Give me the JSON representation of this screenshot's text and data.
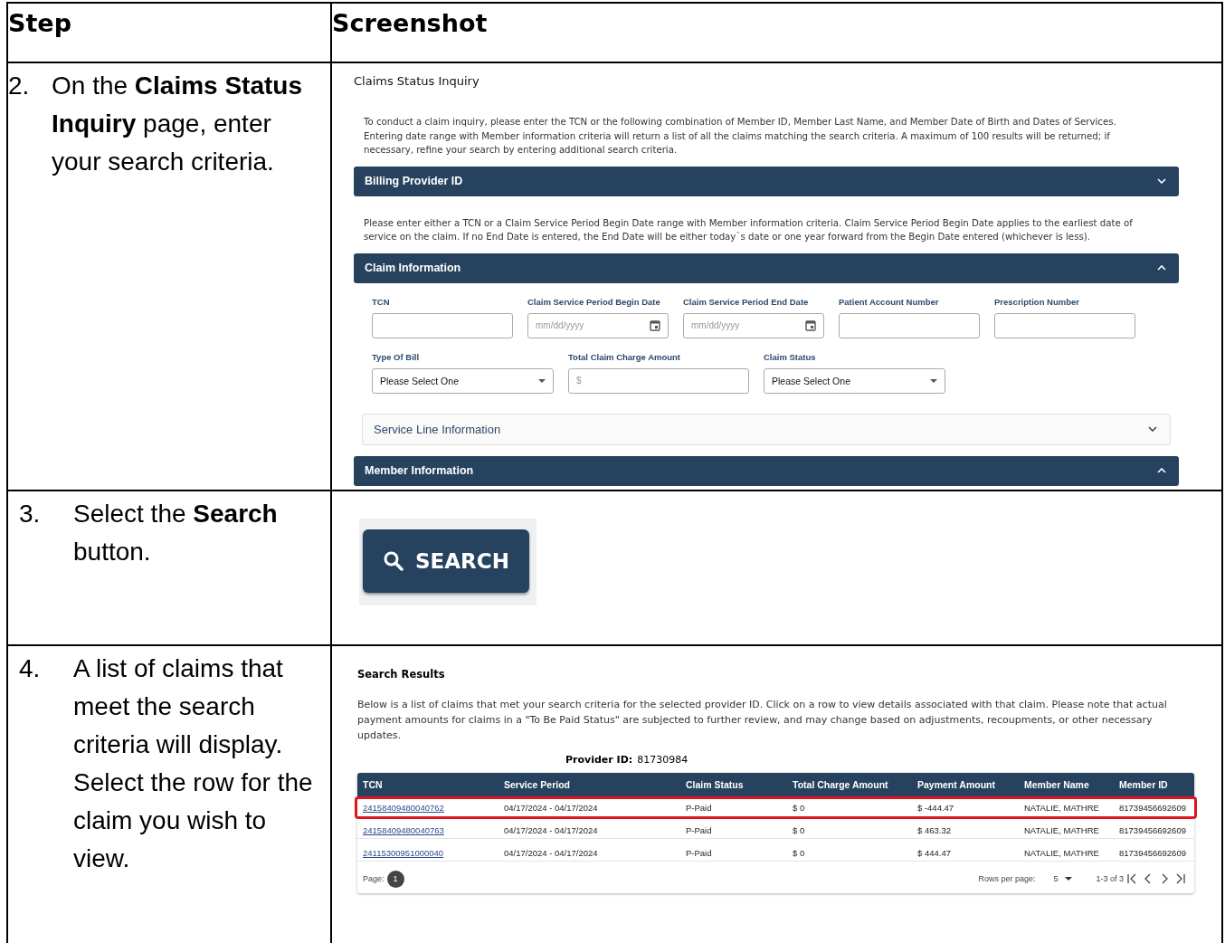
{
  "columns": [
    "Step",
    "Screenshot"
  ],
  "steps": [
    {
      "kind": "inquiry",
      "number": "2.",
      "text": "On the **Claims Status Inquiry** page, enter your search criteria."
    },
    {
      "kind": "search",
      "number": "3.",
      "text": "Select the **Search** button."
    },
    {
      "kind": "results",
      "number": "4.",
      "text": "A list of claims that meet the search criteria will display. Select the row for the claim you wish to view."
    }
  ],
  "inquiry": {
    "title": "Claims Status Inquiry",
    "intro": "To conduct a claim inquiry, please enter the TCN or the following combination of Member ID, Member Last Name, and Member Date of Birth and Dates of Services. Entering date range with Member information criteria will return a list of all the claims matching the search criteria. A maximum of 100 results will be returned; if necessary, refine your search by entering additional search criteria.",
    "billing_section": {
      "title": "Billing Provider ID",
      "expanded": false
    },
    "note": "Please enter either a TCN or a Claim Service Period Begin Date range with Member information criteria. Claim Service Period Begin Date applies to the earliest date of service on the claim. If no End Date is entered, the End Date will be either today`s date or one year forward from the Begin Date entered (whichever is less).",
    "claim_section": {
      "title": "Claim Information",
      "expanded": true
    },
    "fields_row_1": [
      {
        "kind": "text",
        "label": "TCN"
      },
      {
        "kind": "date",
        "label": "Claim Service Period Begin Date",
        "placeholder": "mm/dd/yyyy"
      },
      {
        "kind": "date",
        "label": "Claim Service Period End Date",
        "placeholder": "mm/dd/yyyy"
      },
      {
        "kind": "text",
        "label": "Patient Account Number"
      },
      {
        "kind": "text",
        "label": "Prescription Number"
      }
    ],
    "fields_row_2": [
      {
        "kind": "select",
        "label": "Type Of Bill",
        "value": "Please Select One"
      },
      {
        "kind": "money",
        "label": "Total Claim Charge Amount",
        "placeholder": "$"
      },
      {
        "kind": "select",
        "label": "Claim Status",
        "value": "Please Select One"
      }
    ],
    "service_line_section": {
      "title": "Service Line Information",
      "expanded": false
    },
    "member_section": {
      "title": "Member Information",
      "expanded": true
    }
  },
  "search_button": {
    "label": "SEARCH"
  },
  "results": {
    "title": "Search Results",
    "intro": "Below is a list of claims that met your search criteria for the selected provider ID. Click on a row to view details associated with that claim. Please note that actual payment amounts for claims in a \"To Be Paid Status\" are subjected to further review, and may change based on adjustments, recoupments, or other necessary updates.",
    "provider_label": "Provider ID:",
    "provider_id": "81730984",
    "columns": [
      "TCN",
      "Service Period",
      "Claim Status",
      "Total Charge Amount",
      "Payment Amount",
      "Member Name",
      "Member ID"
    ],
    "rows": [
      {
        "selected": true,
        "cells": [
          "24158409480040762",
          "04/17/2024 - 04/17/2024",
          "P-Paid",
          "$ 0",
          "$ -444.47",
          "NATALIE, MATHRE",
          "81739456692609"
        ]
      },
      {
        "selected": false,
        "cells": [
          "24158409480040763",
          "04/17/2024 - 04/17/2024",
          "P-Paid",
          "$ 0",
          "$ 463.32",
          "NATALIE, MATHRE",
          "81739456692609"
        ]
      },
      {
        "selected": false,
        "cells": [
          "24115300951000040",
          "04/17/2024 - 04/17/2024",
          "P-Paid",
          "$ 0",
          "$ 444.47",
          "NATALIE, MATHRE",
          "81739456692609"
        ]
      }
    ],
    "page_label": "Page:",
    "page": "1",
    "rows_per_page_label": "Rows per page:",
    "rows_per_page": "5",
    "range": "1-3 of 3"
  }
}
